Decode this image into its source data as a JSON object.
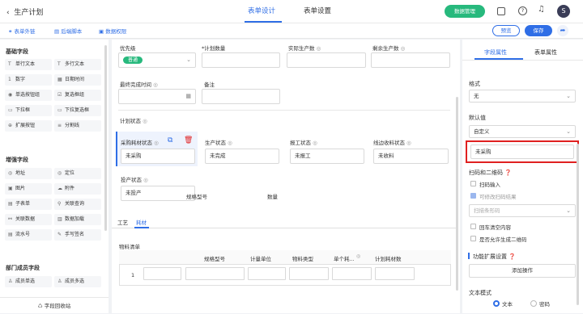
{
  "header": {
    "back_label": "生产计划",
    "tabs": [
      {
        "label": "表单设计"
      },
      {
        "label": "表单设置"
      }
    ],
    "data_mgmt_label": "数据管理",
    "help_icon": "?",
    "avatar_text": "S"
  },
  "toolbar": {
    "items": [
      {
        "label": "表单外链"
      },
      {
        "label": "后端脚本"
      },
      {
        "label": "数据权限"
      }
    ],
    "preview_label": "预览",
    "save_label": "保存"
  },
  "sidebar": {
    "basic_title": "基础字段",
    "basic_items": [
      {
        "label": "单行文本",
        "icon": "text-icon",
        "glyph": "T"
      },
      {
        "label": "多行文本",
        "icon": "multiline-icon",
        "glyph": "T"
      },
      {
        "label": "数字",
        "icon": "number-icon",
        "glyph": "1"
      },
      {
        "label": "日期时间",
        "icon": "calendar-icon",
        "glyph": "▦"
      },
      {
        "label": "单选按钮组",
        "icon": "radio-icon",
        "glyph": "◉"
      },
      {
        "label": "复选框组",
        "icon": "checkbox-icon",
        "glyph": "☑"
      },
      {
        "label": "下拉框",
        "icon": "dropdown-icon",
        "glyph": "▭"
      },
      {
        "label": "下拉复选框",
        "icon": "multi-dropdown-icon",
        "glyph": "▭"
      },
      {
        "label": "扩展按钮",
        "icon": "ext-button-icon",
        "glyph": "⊕"
      },
      {
        "label": "分割线",
        "icon": "divider-icon",
        "glyph": "≡"
      }
    ],
    "enhanced_title": "增强字段",
    "enhanced_items": [
      {
        "label": "地址",
        "icon": "address-icon",
        "glyph": "◎"
      },
      {
        "label": "定位",
        "icon": "location-icon",
        "glyph": "◎"
      },
      {
        "label": "图片",
        "icon": "image-icon",
        "glyph": "▣"
      },
      {
        "label": "附件",
        "icon": "attachment-icon",
        "glyph": "☁"
      },
      {
        "label": "子表单",
        "icon": "subform-icon",
        "glyph": "▤"
      },
      {
        "label": "关联查询",
        "icon": "link-query-icon",
        "glyph": "⚲"
      },
      {
        "label": "关联数据",
        "icon": "link-data-icon",
        "glyph": "⚯"
      },
      {
        "label": "数据加载",
        "icon": "data-load-icon",
        "glyph": "▥"
      },
      {
        "label": "流水号",
        "icon": "serial-icon",
        "glyph": "▤"
      },
      {
        "label": "手写签名",
        "icon": "signature-icon",
        "glyph": "✎"
      }
    ],
    "member_title": "部门成员字段",
    "member_items": [
      {
        "label": "成员单选",
        "icon": "member-single-icon",
        "glyph": "♙"
      },
      {
        "label": "成员多选",
        "icon": "member-multi-icon",
        "glyph": "♙"
      }
    ],
    "recycle_label": "字段回收站"
  },
  "canvas": {
    "row1": [
      {
        "label": "优先级",
        "value": "普通"
      },
      {
        "label": "*计划数量",
        "value": ""
      },
      {
        "label": "实际生产数",
        "value": ""
      },
      {
        "label": "剩余生产数",
        "value": ""
      }
    ],
    "row2": [
      {
        "label": "最终完成时间",
        "value": ""
      },
      {
        "label": "备注",
        "value": ""
      }
    ],
    "section_label": "计划状态",
    "row3": [
      {
        "label": "采购耗材状态",
        "value": "未采购"
      },
      {
        "label": "生产状态",
        "value": "未完成"
      },
      {
        "label": "报工状态",
        "value": "未报工"
      },
      {
        "label": "线边收料状态",
        "value": "未收料"
      }
    ],
    "row4": [
      {
        "label": "投产状态",
        "value": "未投产"
      }
    ],
    "table_fields": [
      {
        "label": "规格型号"
      },
      {
        "label": "数量"
      }
    ],
    "tabs": [
      {
        "label": "工艺"
      },
      {
        "label": "耗材"
      }
    ],
    "subtable": {
      "title": "物料清单",
      "columns": [
        "规格型号",
        "计量单位",
        "物料类型",
        "单个耗...",
        "计划耗材数"
      ],
      "row_index": "1"
    }
  },
  "panel": {
    "tabs": [
      {
        "label": "字段属性"
      },
      {
        "label": "表单属性"
      }
    ],
    "format_label": "格式",
    "format_value": "无",
    "default_label": "默认值",
    "default_mode": "自定义",
    "default_value": "未采购",
    "scan_title": "扫码和二维码",
    "scan_options": [
      {
        "label": "扫码输入",
        "checked": false,
        "disabled": false
      },
      {
        "label": "可修改扫码结果",
        "checked": true,
        "disabled": true
      }
    ],
    "scan_select": "扫描条形码",
    "scan_options2": [
      {
        "label": "回车清空内容",
        "checked": false
      },
      {
        "label": "是否允许生成二维码",
        "checked": false
      }
    ],
    "ext_title": "功能扩展设置",
    "add_action_label": "添加操作",
    "text_mode_label": "文本模式",
    "text_mode_options": [
      {
        "label": "文本",
        "selected": true
      },
      {
        "label": "密码",
        "selected": false
      }
    ]
  },
  "colors": {
    "primary": "#2f6ee6",
    "green": "#27b97d",
    "highlight": "#e02020"
  }
}
